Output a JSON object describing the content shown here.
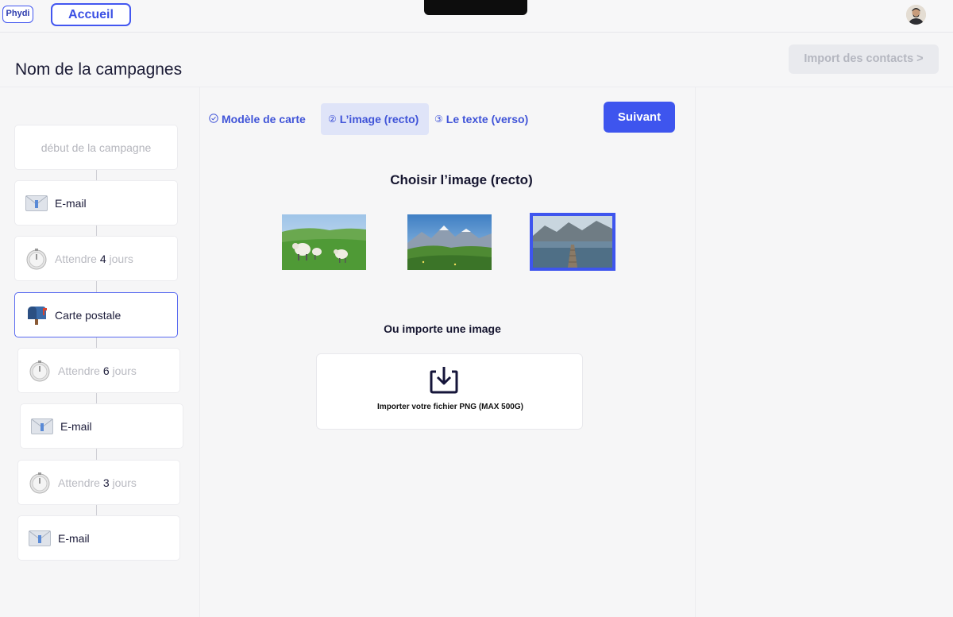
{
  "header": {
    "logo_text": "Phydi",
    "home_button": "Accueil",
    "avatar_icon": "user-avatar"
  },
  "page": {
    "title": "Nom de la campagnes",
    "import_contacts": "Import des contacts >"
  },
  "timeline": {
    "start_label": "début de la campagne",
    "items": [
      {
        "type": "email",
        "icon": "envelope-icon",
        "label": "E-mail"
      },
      {
        "type": "wait",
        "icon": "timer-icon",
        "prefix": "Attendre",
        "count": "4",
        "suffix": "jours"
      },
      {
        "type": "postcard",
        "icon": "mailbox-icon",
        "label": "Carte postale"
      },
      {
        "type": "wait",
        "icon": "timer-icon",
        "prefix": "Attendre",
        "count": "6",
        "suffix": "jours"
      },
      {
        "type": "email",
        "icon": "envelope-icon",
        "label": "E-mail"
      },
      {
        "type": "wait",
        "icon": "timer-icon",
        "prefix": "Attendre",
        "count": "3",
        "suffix": "jours"
      },
      {
        "type": "email",
        "icon": "envelope-icon",
        "label": "E-mail"
      }
    ]
  },
  "steps": {
    "tabs": [
      {
        "marker": "⊘",
        "label": "Modèle de carte"
      },
      {
        "marker": "②",
        "label": "L’image (recto)"
      },
      {
        "marker": "③",
        "label": "Le texte (verso)"
      }
    ],
    "next_button": "Suivant"
  },
  "image_picker": {
    "title": "Choisir l’image (recto)",
    "images": [
      {
        "name": "sheep-meadow"
      },
      {
        "name": "mountain-valley"
      },
      {
        "name": "lake-pier",
        "selected": true
      }
    ],
    "import_title": "Ou importe une image",
    "upload_label": "Importer votre fichier PNG (MAX 500G)"
  },
  "colors": {
    "accent": "#3e55ee",
    "tab_active_bg": "#dfe4f8"
  }
}
